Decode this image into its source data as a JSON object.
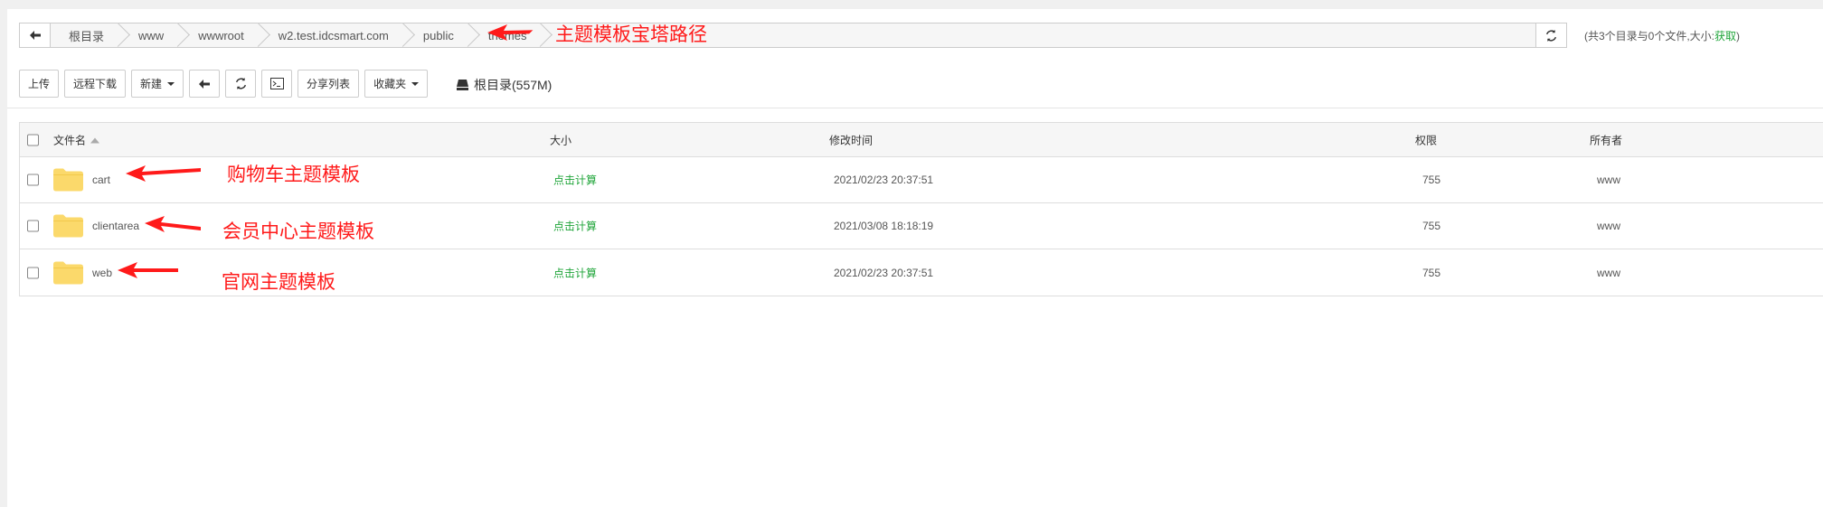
{
  "breadcrumb": {
    "back_icon": "arrow-left-icon",
    "items": [
      "根目录",
      "www",
      "wwwroot",
      "w2.test.idcsmart.com",
      "public",
      "themes"
    ],
    "refresh_icon": "refresh-icon"
  },
  "summary": {
    "text": "(共3个目录与0个文件,大小:",
    "fetch_label": "获取",
    "close": ")"
  },
  "toolbar": {
    "upload": "上传",
    "remote_download": "远程下载",
    "new": "新建",
    "share_list": "分享列表",
    "favorites": "收藏夹",
    "disk_label": "根目录(557M)"
  },
  "table": {
    "headers": {
      "name": "文件名",
      "size": "大小",
      "modified": "修改时间",
      "perm": "权限",
      "owner": "所有者"
    },
    "rows": [
      {
        "name": "cart",
        "size": "点击计算",
        "modified": "2021/02/23 20:37:51",
        "perm": "755",
        "owner": "www"
      },
      {
        "name": "clientarea",
        "size": "点击计算",
        "modified": "2021/03/08 18:18:19",
        "perm": "755",
        "owner": "www"
      },
      {
        "name": "web",
        "size": "点击计算",
        "modified": "2021/02/23 20:37:51",
        "perm": "755",
        "owner": "www"
      }
    ]
  },
  "annotations": {
    "path_note": "主题模板宝塔路径",
    "cart_note": "购物车主题模板",
    "clientarea_note": "会员中心主题模板",
    "web_note": "官网主题模板"
  },
  "colors": {
    "accent_green": "#20a53a",
    "annotation_red": "#ff1a1a",
    "folder_yellow": "#fbd96b"
  }
}
